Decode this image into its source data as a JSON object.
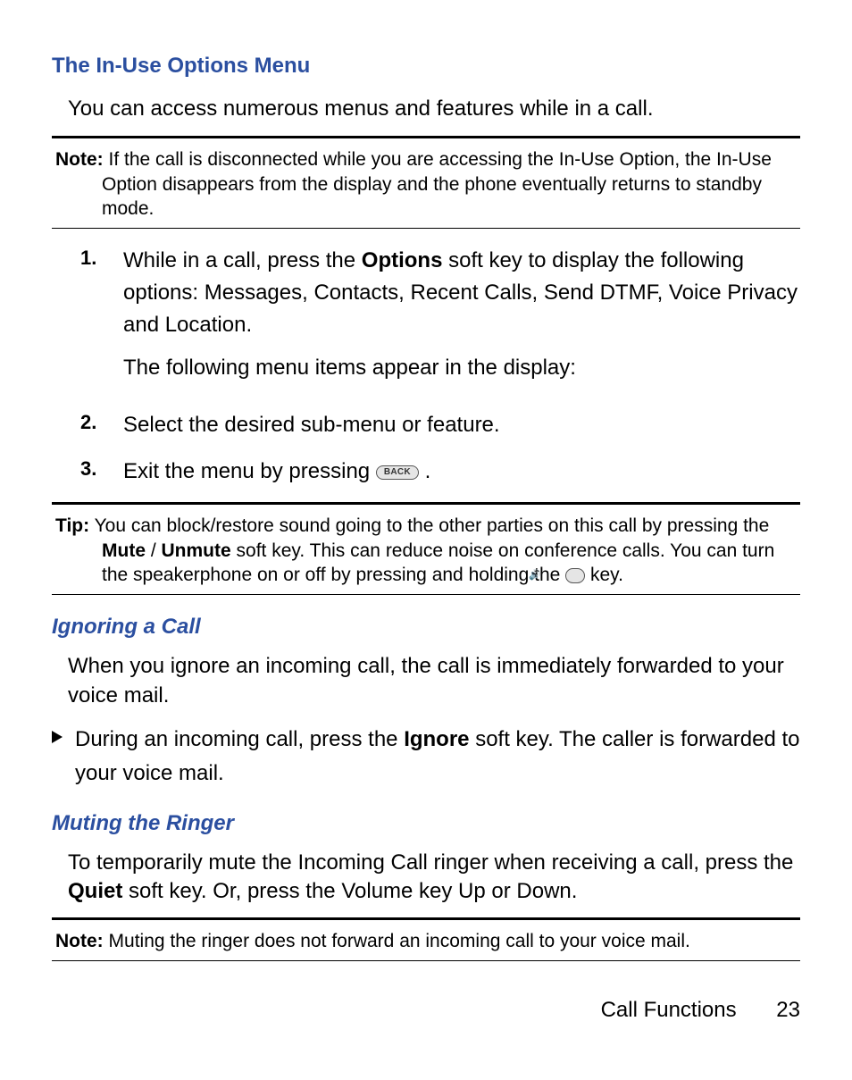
{
  "section1": {
    "heading": "The In-Use Options Menu",
    "intro": "You can access numerous menus and features while in a call."
  },
  "note1": {
    "label": "Note:",
    "text": "If the call is disconnected while you are accessing the In-Use Option, the In-Use Option disappears from the display and the phone eventually returns to standby mode."
  },
  "steps": [
    {
      "num": "1.",
      "lead": "While in a call, press the ",
      "bold": "Options",
      "tail": " soft key to display the following options: Messages, Contacts, Recent Calls, Send DTMF, Voice Privacy and Location.",
      "extra": "The following menu items appear in the display:"
    },
    {
      "num": "2.",
      "lead": "Select the desired sub-menu or feature.",
      "bold": "",
      "tail": "",
      "extra": ""
    },
    {
      "num": "3.",
      "lead": "Exit the menu by pressing ",
      "bold": "",
      "tail": ".",
      "keylabel": "BACK",
      "extra": ""
    }
  ],
  "tip": {
    "label": "Tip:",
    "p1a": "You can block/restore sound going to the other parties on this call by pressing the ",
    "p1b": "Mute",
    "p1c": " / ",
    "p1d": "Unmute",
    "p1e": " soft key. This can reduce noise on conference calls. You can turn the speakerphone on or off by pressing and holding the ",
    "keyglyph": "🔊",
    "p1f": " key."
  },
  "section2": {
    "heading": "Ignoring a Call",
    "p1": "When you ignore an incoming call, the call is immediately forwarded to your voice mail.",
    "bullet_lead": "During an incoming call, press the ",
    "bullet_bold": "Ignore",
    "bullet_tail": " soft key. The caller is forwarded to your voice mail."
  },
  "section3": {
    "heading": "Muting the Ringer",
    "p1a": "To temporarily mute the Incoming Call ringer when receiving a call, press the ",
    "p1b": "Quiet",
    "p1c": " soft key. Or, press the Volume key Up or Down."
  },
  "note2": {
    "label": "Note:",
    "text": "Muting the ringer does not forward an incoming call to your voice mail."
  },
  "footer": {
    "title": "Call Functions",
    "page": "23"
  }
}
